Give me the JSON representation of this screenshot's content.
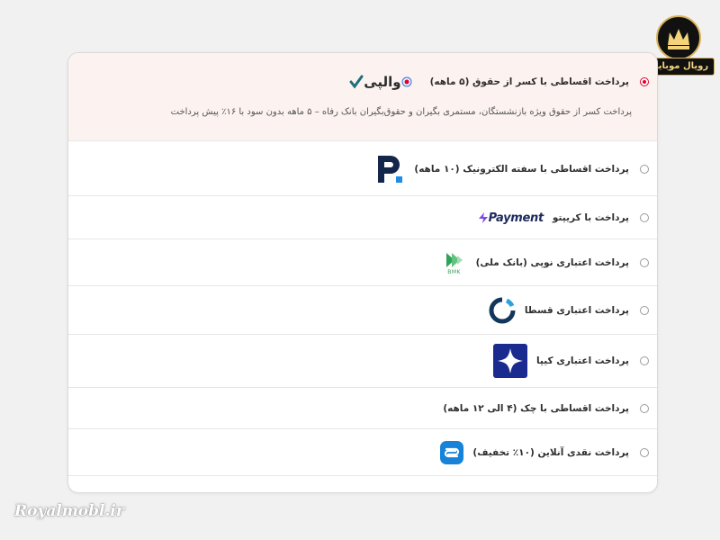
{
  "options": [
    {
      "label": "پرداخت اقساطی با کسر از حقوق (۵ ماهه)",
      "selected": true,
      "logo": "wallpay-logo",
      "logo_text": "والپی",
      "description": "پرداخت کسر از حقوق ویژه بازنشستگان، مستمری بگیران و حقوق‌بگیران بانک رفاه – ۵ ماهه بدون سود با ۱۶٪ پیش پرداخت"
    },
    {
      "label": "پرداخت اقساطی با سفته الکترونیک (۱۰ ماهه)",
      "selected": false,
      "logo": "p-logo"
    },
    {
      "label": "پرداخت با کریپتو",
      "selected": false,
      "logo": "payment4-logo",
      "logo_text": "Payment"
    },
    {
      "label": "پرداخت اعتباری نوپی (بانک ملی)",
      "selected": false,
      "logo": "bmk-logo",
      "logo_text": "BMK"
    },
    {
      "label": "پرداخت اعتباری قسطا",
      "selected": false,
      "logo": "ghesta-logo"
    },
    {
      "label": "پرداخت اعتباری کیپا",
      "selected": false,
      "logo": "kipa-logo"
    },
    {
      "label": "پرداخت اقساطی با چک (۴ الی ۱۲ ماهه)",
      "selected": false,
      "logo": ""
    },
    {
      "label": "پرداخت نقدی آنلاین (۱۰٪ تخفیف)",
      "selected": false,
      "logo": "online-pay-logo"
    }
  ],
  "brand": {
    "name": "رویال موبایل",
    "watermark": "Royalmobl.ir"
  },
  "colors": {
    "accent": "#e0002b",
    "highlight_bg": "#fcf3f1"
  }
}
